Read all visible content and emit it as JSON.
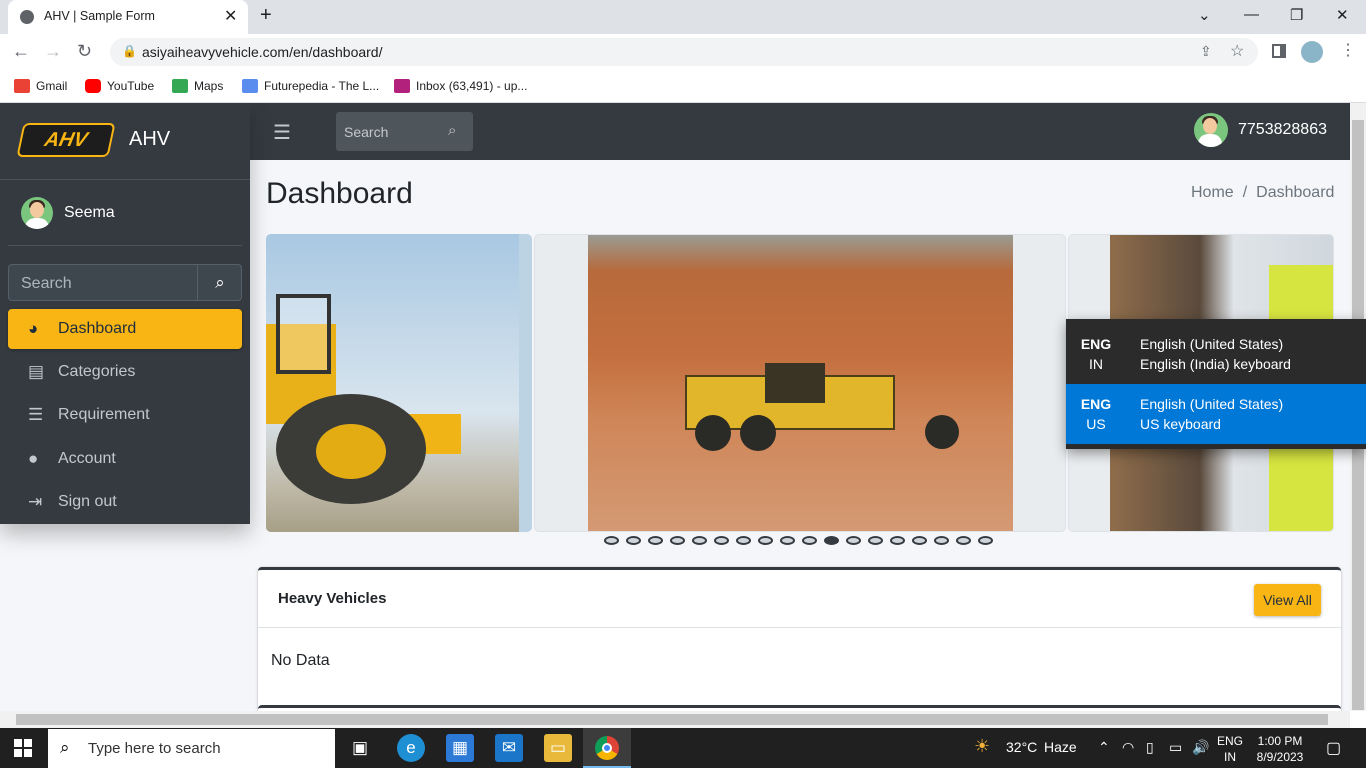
{
  "browser": {
    "tab_title": "AHV | Sample Form",
    "url": "asiyaiheavyvehicle.com/en/dashboard/",
    "bookmarks": [
      "Gmail",
      "YouTube",
      "Maps",
      "Futurepedia - The L...",
      "Inbox (63,491) - up..."
    ]
  },
  "sidebar": {
    "brand": "AHV",
    "logo_text": "AHV",
    "user": "Seema",
    "search_placeholder": "Search",
    "items": [
      {
        "label": "Dashboard",
        "icon": "tachometer-icon",
        "active": true
      },
      {
        "label": "Categories",
        "icon": "clipboard-icon",
        "active": false
      },
      {
        "label": "Requirement",
        "icon": "list-icon",
        "active": false
      },
      {
        "label": "Account",
        "icon": "user-circle-icon",
        "active": false
      },
      {
        "label": "Sign out",
        "icon": "sign-out-icon",
        "active": false
      }
    ]
  },
  "topnav": {
    "search_placeholder": "Search",
    "phone": "7753828863"
  },
  "main": {
    "title": "Dashboard",
    "breadcrumb": [
      "Home",
      "Dashboard"
    ],
    "carousel": {
      "dot_count": 18,
      "active_index": 10
    },
    "card": {
      "title": "Heavy Vehicles",
      "view_all": "View All",
      "empty": "No Data"
    }
  },
  "lang_popup": [
    {
      "code1": "ENG",
      "code2": "IN",
      "line1": "English (United States)",
      "line2": "English (India) keyboard",
      "selected": false
    },
    {
      "code1": "ENG",
      "code2": "US",
      "line1": "English (United States)",
      "line2": "US keyboard",
      "selected": true
    }
  ],
  "taskbar": {
    "search_placeholder": "Type here to search",
    "weather_temp": "32°C",
    "weather_desc": "Haze",
    "lang1": "ENG",
    "lang2": "IN",
    "time": "1:00 PM",
    "date": "8/9/2023"
  },
  "colors": {
    "accent": "#f8b514",
    "sidebar": "#343a40",
    "selected_lang": "#0078d7"
  }
}
